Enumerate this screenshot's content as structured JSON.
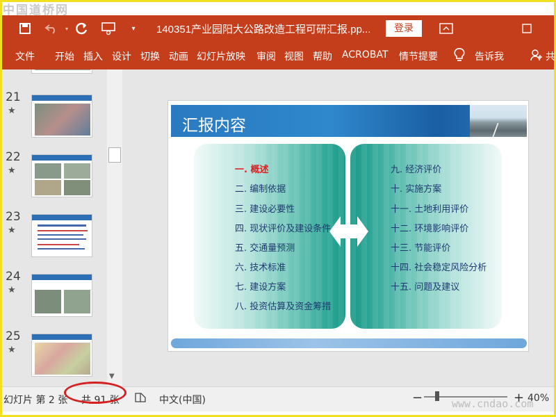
{
  "watermark_top": "中国道桥网",
  "watermark_bottom": "www.cndao.com",
  "titlebar": {
    "title": "140351产业园阳大公路改造工程可研汇报.pp...",
    "login_label": "登录",
    "icons": [
      "save-icon",
      "undo-icon",
      "redo-icon",
      "presenter-icon",
      "customize-icon",
      "ribbon-display-icon",
      "maximize-icon"
    ]
  },
  "ribbon": {
    "tabs": [
      "文件",
      "开始",
      "插入",
      "设计",
      "切换",
      "动画",
      "幻灯片放映",
      "审阅",
      "视图",
      "帮助",
      "ACROBAT",
      "情节提要"
    ],
    "tell_me": "告诉我",
    "share_label": "共"
  },
  "thumbnails": [
    {
      "number": "21",
      "star": "★"
    },
    {
      "number": "22",
      "star": "★"
    },
    {
      "number": "23",
      "star": "★"
    },
    {
      "number": "24",
      "star": "★"
    },
    {
      "number": "25",
      "star": "★"
    }
  ],
  "slide": {
    "title": "汇报内容",
    "left_items": [
      "一. 概述",
      "二. 编制依据",
      "三. 建设必要性",
      "四. 现状评价及建设条件",
      "五. 交通量预测",
      "六. 技术标准",
      "七. 建设方案",
      "八. 投资估算及资金筹措"
    ],
    "right_items": [
      "九. 经济评价",
      "十. 实施方案",
      "十一. 土地利用评价",
      "十二. 环境影响评价",
      "十三. 节能评价",
      "十四. 社会稳定风险分析",
      "十五. 问题及建议"
    ],
    "active_color": "#e02020",
    "item_color": "#1f3a70"
  },
  "statusbar": {
    "slide_info": "幻灯片 第 2 张",
    "total": "共 91 张",
    "language": "中文(中国)",
    "zoom_minus": "−",
    "zoom_plus": "+",
    "zoom": "40%"
  },
  "colors": {
    "ribbon": "#c43e1c",
    "highlight_oval": "#d42020"
  }
}
